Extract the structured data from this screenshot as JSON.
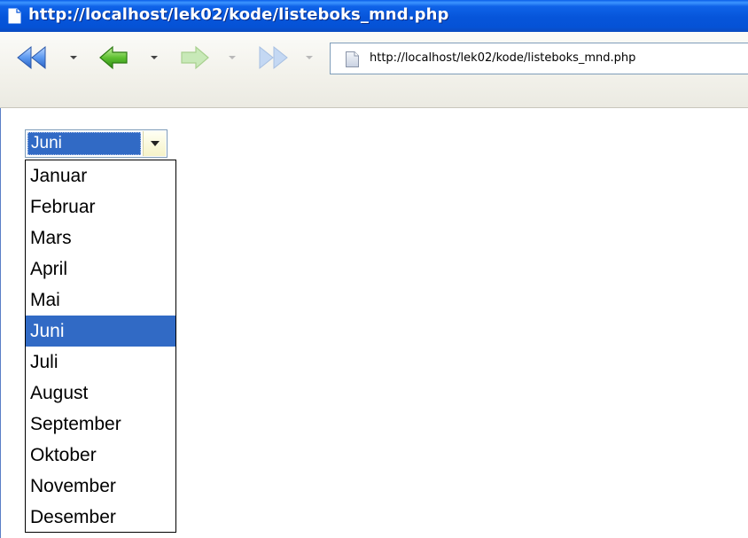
{
  "window": {
    "title": "http://localhost/lek02/kode/listeboks_mnd.php"
  },
  "toolbar": {
    "buttons": [
      {
        "name": "rewind-icon",
        "enabled": true
      },
      {
        "name": "back-icon",
        "enabled": true
      },
      {
        "name": "forward-icon",
        "enabled": false
      },
      {
        "name": "fast-forward-icon",
        "enabled": false
      }
    ],
    "address": "http://localhost/lek02/kode/listeboks_mnd.php"
  },
  "colors": {
    "titlebar": "#0655da",
    "selection": "#316ac5",
    "nav_green": "#3fa81e",
    "nav_blue": "#3e7fd6"
  },
  "month_select": {
    "value": "Juni",
    "options": [
      "Januar",
      "Februar",
      "Mars",
      "April",
      "Mai",
      "Juni",
      "Juli",
      "August",
      "September",
      "Oktober",
      "November",
      "Desember"
    ],
    "selected_index": 5
  }
}
